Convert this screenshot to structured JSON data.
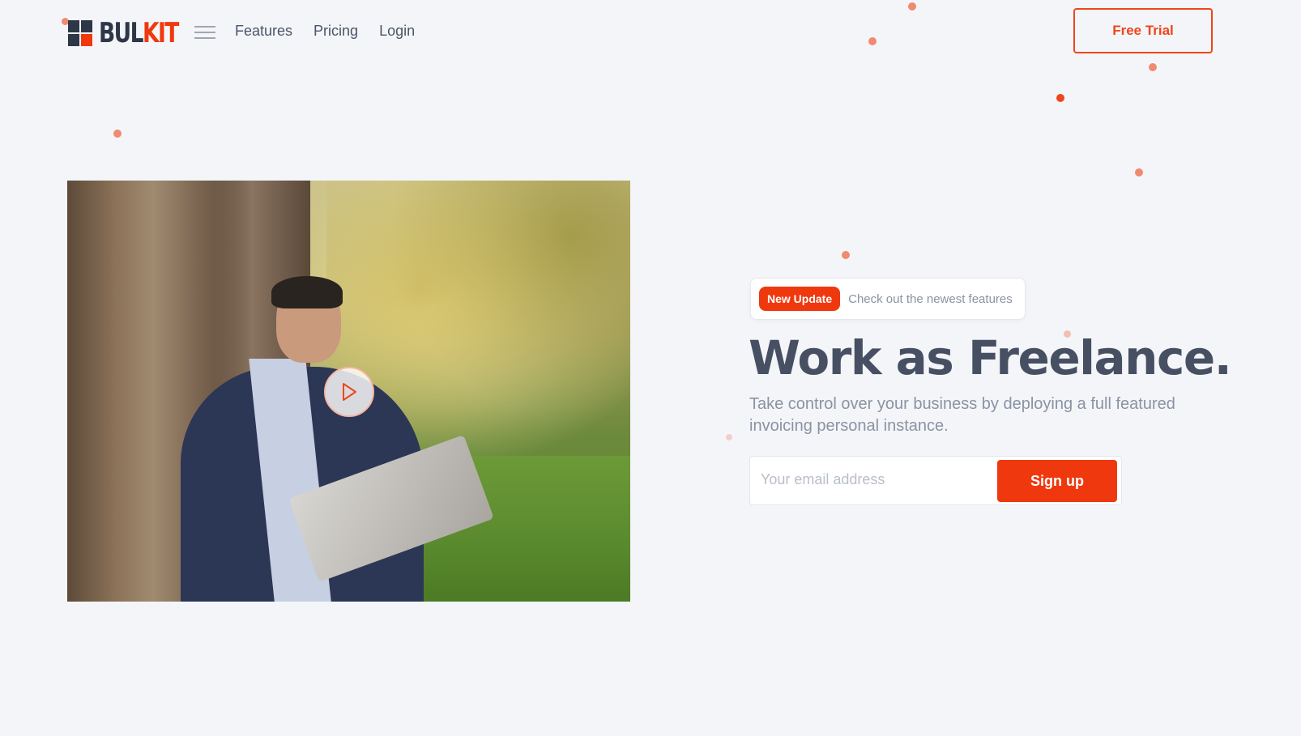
{
  "colors": {
    "accent": "#f0380e",
    "logo_dark": "#2d3748",
    "heading": "#475063",
    "muted_text": "#8a93a3",
    "background": "#f4f5f8",
    "decor_dot": "#f08a70"
  },
  "header": {
    "logo": {
      "part1": "BUL",
      "part2": "KIT"
    },
    "menu_icon": "hamburger-icon",
    "nav": [
      {
        "label": "Features"
      },
      {
        "label": "Pricing"
      },
      {
        "label": "Login"
      }
    ],
    "cta_label": "Free Trial"
  },
  "hero": {
    "image": {
      "description": "Man in navy suit leaning against a tree using a laptop in a sunny park",
      "play_icon": "play-icon"
    },
    "badge": {
      "pill": "New Update",
      "text": "Check out the newest features"
    },
    "headline": "Work as Freelance.",
    "subheadline": "Take control over your business by deploying a full featured invoicing personal instance.",
    "form": {
      "email_placeholder": "Your email address",
      "email_value": "",
      "submit_label": "Sign up"
    }
  }
}
